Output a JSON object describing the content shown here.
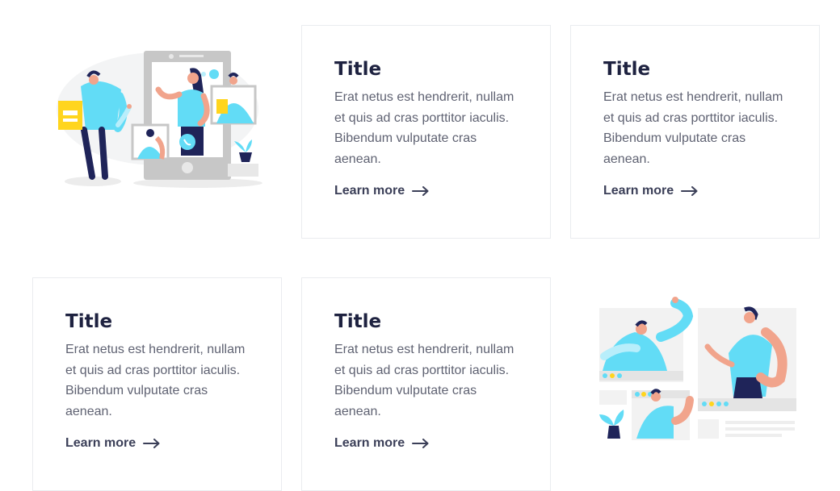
{
  "cards": [
    {
      "title": "Title",
      "body": "Erat netus est hendrerit, nullam et quis ad cras porttitor iaculis. Bibendum vulputate cras aenean.",
      "link": "Learn more"
    },
    {
      "title": "Title",
      "body": "Erat netus est hendrerit, nullam et quis ad cras porttitor iaculis. Bibendum vulputate cras aenean.",
      "link": "Learn more"
    },
    {
      "title": "Title",
      "body": "Erat netus est hendrerit, nullam et quis ad cras porttitor iaculis. Bibendum vulputate cras aenean.",
      "link": "Learn more"
    },
    {
      "title": "Title",
      "body": "Erat netus est hendrerit, nullam et quis ad cras porttitor iaculis. Bibendum vulputate cras aenean.",
      "link": "Learn more"
    }
  ],
  "icons": {
    "link_arrow": "arrow-right-icon",
    "illustration_top": "phone-video-call-illustration",
    "illustration_bottom": "group-video-call-illustration"
  },
  "colors": {
    "title": "#1e2240",
    "body": "#5f6272",
    "link": "#3b3f58",
    "card_border": "#eaecef",
    "accent_cyan": "#62dcf6",
    "accent_yellow": "#ffd51e",
    "accent_navy": "#1f2459",
    "skin": "#f1a48c"
  }
}
